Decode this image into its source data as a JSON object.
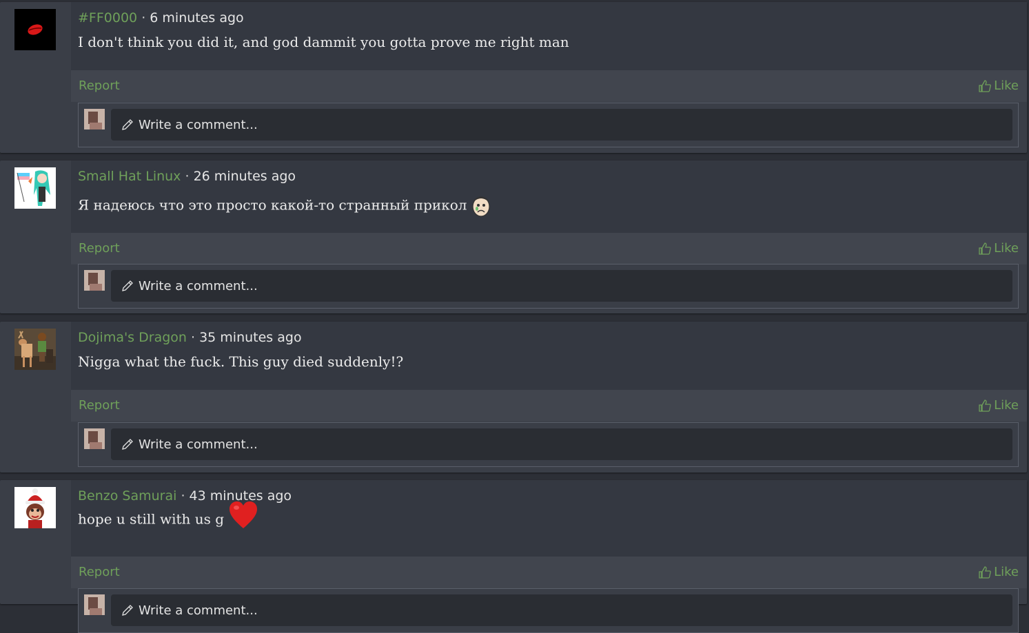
{
  "comments": [
    {
      "author": "#FF0000",
      "time": "6 minutes ago",
      "text": "I don't think you did it, and god dammit you gotta prove me right man",
      "report": "Report",
      "like": "Like",
      "reply_placeholder": "Write a comment...",
      "avatar_icon": "red-lips-avatar",
      "emoji": ""
    },
    {
      "author": "Small Hat Linux",
      "time": "26 minutes ago",
      "text": "Я надеюсь что это просто какой-то странный прикол",
      "report": "Report",
      "like": "Like",
      "reply_placeholder": "Write a comment...",
      "avatar_icon": "anime-character-flag-avatar",
      "emoji": "worried-face-emoji"
    },
    {
      "author": "Dojima's Dragon",
      "time": "35 minutes ago",
      "text": "Nigga what the fuck. This guy died suddenly!?",
      "report": "Report",
      "like": "Like",
      "reply_placeholder": "Write a comment...",
      "avatar_icon": "deer-character-avatar",
      "emoji": ""
    },
    {
      "author": "Benzo Samurai",
      "time": "43 minutes ago",
      "text": "hope u still with us g",
      "report": "Report",
      "like": "Like",
      "reply_placeholder": "Write a comment...",
      "avatar_icon": "monkey-santa-hat-avatar",
      "emoji": "red-heart-emoji"
    }
  ],
  "separator": "·",
  "colors": {
    "accent": "#6fa05a",
    "panel": "#343841",
    "actions_bar": "#41454e",
    "input": "#2a2d33"
  }
}
